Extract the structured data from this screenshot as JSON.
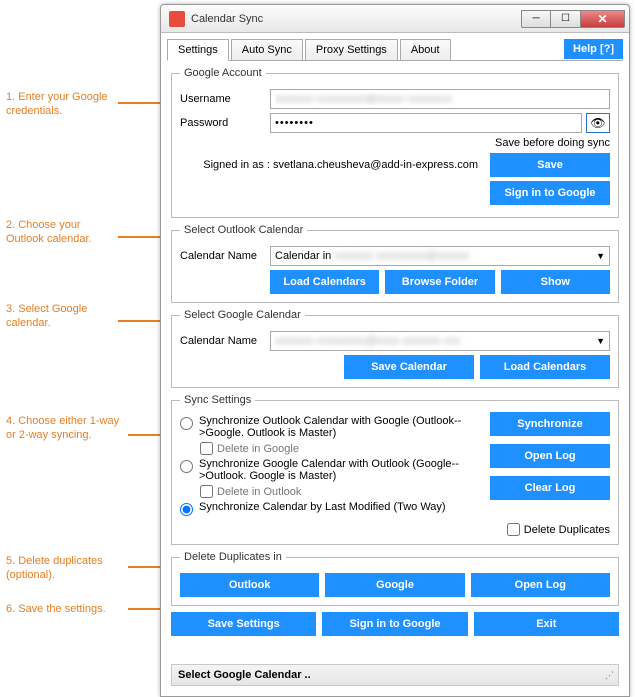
{
  "window": {
    "title": "Calendar Sync"
  },
  "tabs": {
    "settings": "Settings",
    "autosync": "Auto Sync",
    "proxy": "Proxy Settings",
    "about": "About",
    "help": "Help [?]"
  },
  "google_account": {
    "legend": "Google Account",
    "username_label": "Username",
    "password_label": "Password",
    "password_value": "••••••••",
    "save_hint": "Save before doing sync",
    "signed_in_label": "Signed in as : svetlana.cheusheva@add-in-express.com",
    "save_btn": "Save",
    "signin_btn": "Sign in to Google"
  },
  "outlook_cal": {
    "legend": "Select Outlook Calendar",
    "name_label": "Calendar Name",
    "value_prefix": "Calendar in",
    "load_btn": "Load Calendars",
    "browse_btn": "Browse Folder",
    "show_btn": "Show"
  },
  "google_cal": {
    "legend": "Select Google Calendar",
    "name_label": "Calendar Name",
    "save_btn": "Save Calendar",
    "load_btn": "Load Calendars"
  },
  "sync": {
    "legend": "Sync Settings",
    "opt1": "Synchronize Outlook Calendar with Google (Outlook-->Google. Outlook is Master)",
    "opt1_del": "Delete in Google",
    "opt2": "Synchronize Google Calendar with Outlook (Google-->Outlook. Google is Master)",
    "opt2_del": "Delete in Outlook",
    "opt3": "Synchronize Calendar by Last Modified (Two Way)",
    "sync_btn": "Synchronize",
    "openlog_btn": "Open Log",
    "clearlog_btn": "Clear Log",
    "deldup_chk": "Delete Duplicates"
  },
  "dup": {
    "legend": "Delete Duplicates in",
    "outlook_btn": "Outlook",
    "google_btn": "Google",
    "openlog_btn": "Open Log"
  },
  "bottom": {
    "save_btn": "Save Settings",
    "signin_btn": "Sign in to Google",
    "exit_btn": "Exit"
  },
  "status": {
    "text": "Select Google Calendar .."
  },
  "annotations": {
    "a1": "1. Enter your Google credentials.",
    "a2": "2. Choose your Outlook calendar.",
    "a3": "3. Select Google calendar.",
    "a4": "4. Choose either 1-way or 2-way syncing.",
    "a5": "5. Delete duplicates (optional).",
    "a6": "6. Save the settings."
  }
}
